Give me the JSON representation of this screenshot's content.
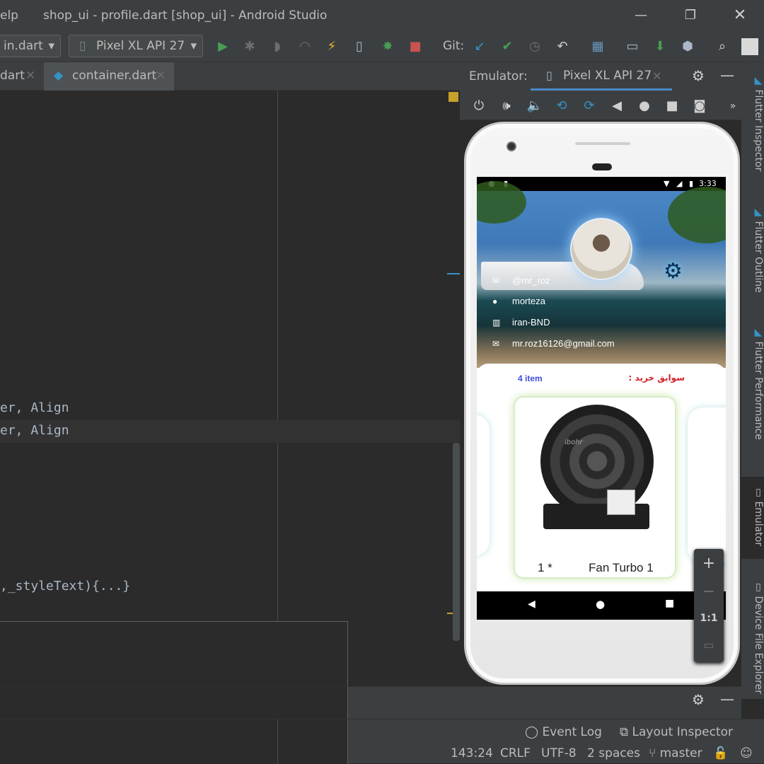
{
  "window": {
    "menu_fragment": "elp",
    "title": "shop_ui - profile.dart [shop_ui] - Android Studio"
  },
  "toolbar": {
    "run_config": "in.dart",
    "device": "Pixel XL API 27",
    "git_label": "Git:"
  },
  "editor_tabs": [
    {
      "label": "dart"
    },
    {
      "label": "container.dart"
    }
  ],
  "code_lines": [
    "er, Align",
    "er, Align",
    ",_styleText){...}"
  ],
  "emulator": {
    "header_label": "Emulator:",
    "device_tab": "Pixel XL API 27"
  },
  "side_tabs": [
    "Flutter Inspector",
    "Flutter Outline",
    "Flutter Performance",
    "Emulator",
    "Device File Explorer"
  ],
  "app": {
    "time": "3:33",
    "profile": {
      "handle": "@mr_roz",
      "name": "morteza",
      "location": "iran-BND",
      "email": "mr.roz16126@gmail.com"
    },
    "history_title": "سوابق خرید  :",
    "item_count": "4 item",
    "product": {
      "brand": "ibohr",
      "name": "Fan Turbo 1",
      "quantity": "1 *"
    }
  },
  "zoom": {
    "plus": "+",
    "minus": "−",
    "one_to_one": "1:1"
  },
  "bottom_links": {
    "event_log": "Event Log",
    "layout_inspector": "Layout Inspector"
  },
  "status": {
    "position": "143:24",
    "line_sep": "CRLF",
    "encoding": "UTF-8",
    "indent": "2 spaces",
    "branch": "master"
  },
  "colors": {
    "accent_blue": "#3592c4",
    "run_green": "#499c54",
    "stop_red": "#c75450",
    "item_count_blue": "#3a4fd8",
    "history_red": "#d0202a"
  }
}
